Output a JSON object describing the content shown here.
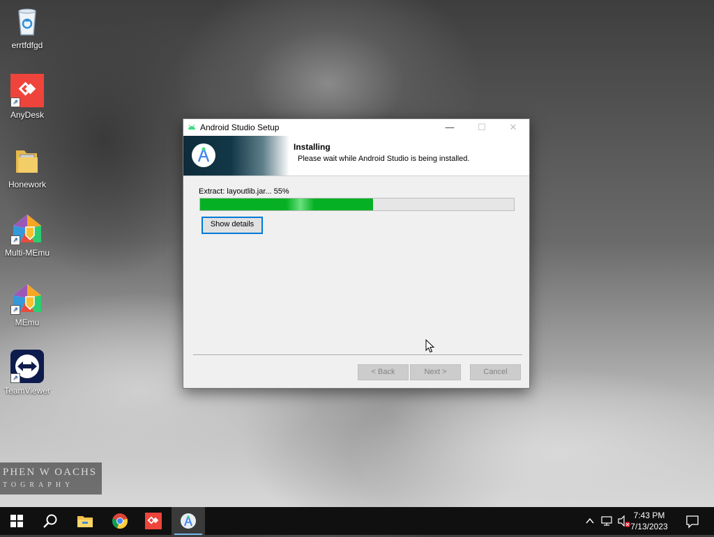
{
  "desktop": {
    "icons": [
      {
        "label": "errtfdfgd",
        "icon": "recycle-bin-icon"
      },
      {
        "label": "AnyDesk",
        "icon": "anydesk-icon"
      },
      {
        "label": "Honework",
        "icon": "folder-icon"
      },
      {
        "label": "Multi-MEmu",
        "icon": "multi-memu-icon"
      },
      {
        "label": "MEmu",
        "icon": "memu-icon"
      },
      {
        "label": "TeamViewer",
        "icon": "teamviewer-icon"
      }
    ],
    "watermark": {
      "line1": "PHEN W OACHS",
      "line2": "TOGRAPHY"
    }
  },
  "dialog": {
    "title": "Android Studio Setup",
    "heading": "Installing",
    "subheading": "Please wait while Android Studio is being installed.",
    "status": "Extract: layoutlib.jar... 55%",
    "progress": 0.55,
    "show_details": "Show details",
    "back": "< Back",
    "next": "Next >",
    "cancel": "Cancel",
    "minimize": "—",
    "maximize": "☐",
    "close": "✕"
  },
  "taskbar": {
    "items": [
      "start-icon",
      "search-icon",
      "file-explorer-icon",
      "chrome-icon",
      "anydesk-icon",
      "android-studio-setup-icon"
    ],
    "time": "7:43 PM",
    "date": "7/13/2023",
    "tray": {
      "chevron": "^"
    }
  },
  "colors": {
    "progress": "#06b025",
    "focus": "#0078d7",
    "taskbar": "#101010",
    "anydesk": "#ef443b"
  }
}
